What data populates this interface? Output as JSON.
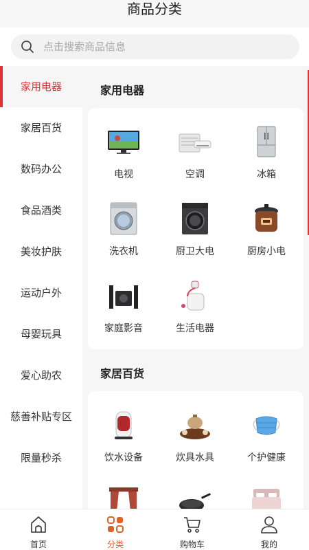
{
  "header": {
    "title": "商品分类"
  },
  "search": {
    "placeholder": "点击搜索商品信息",
    "icon": "search-icon"
  },
  "accent_color": "#e03236",
  "sidebar": {
    "items": [
      {
        "label": "家用电器",
        "active": true
      },
      {
        "label": "家居百货"
      },
      {
        "label": "数码办公"
      },
      {
        "label": "食品酒类"
      },
      {
        "label": "美妆护肤"
      },
      {
        "label": "运动户外"
      },
      {
        "label": "母婴玩具"
      },
      {
        "label": "爱心助农"
      },
      {
        "label": "慈善补贴专区"
      },
      {
        "label": "限量秒杀"
      }
    ]
  },
  "sections": [
    {
      "title": "家用电器",
      "items": [
        {
          "label": "电视",
          "icon": "tv-icon"
        },
        {
          "label": "空调",
          "icon": "air-conditioner-icon"
        },
        {
          "label": "冰箱",
          "icon": "fridge-icon"
        },
        {
          "label": "洗衣机",
          "icon": "washing-machine-icon"
        },
        {
          "label": "厨卫大电",
          "icon": "front-loader-icon"
        },
        {
          "label": "厨房小电",
          "icon": "pressure-cooker-icon"
        },
        {
          "label": "家庭影音",
          "icon": "speaker-icon"
        },
        {
          "label": "生活电器",
          "icon": "garment-steamer-icon"
        }
      ]
    },
    {
      "title": "家居百货",
      "items": [
        {
          "label": "饮水设备",
          "icon": "kettle-icon"
        },
        {
          "label": "炊具水具",
          "icon": "tea-set-icon"
        },
        {
          "label": "个护健康",
          "icon": "face-mask-icon"
        },
        {
          "label": "",
          "icon": "curtain-icon"
        },
        {
          "label": "",
          "icon": "frying-pan-icon"
        },
        {
          "label": "",
          "icon": "bed-icon"
        }
      ]
    }
  ],
  "tabbar": {
    "items": [
      {
        "label": "首页",
        "icon": "home-icon"
      },
      {
        "label": "分类",
        "icon": "category-icon",
        "active": true
      },
      {
        "label": "购物车",
        "icon": "cart-icon"
      },
      {
        "label": "我的",
        "icon": "user-icon"
      }
    ]
  }
}
